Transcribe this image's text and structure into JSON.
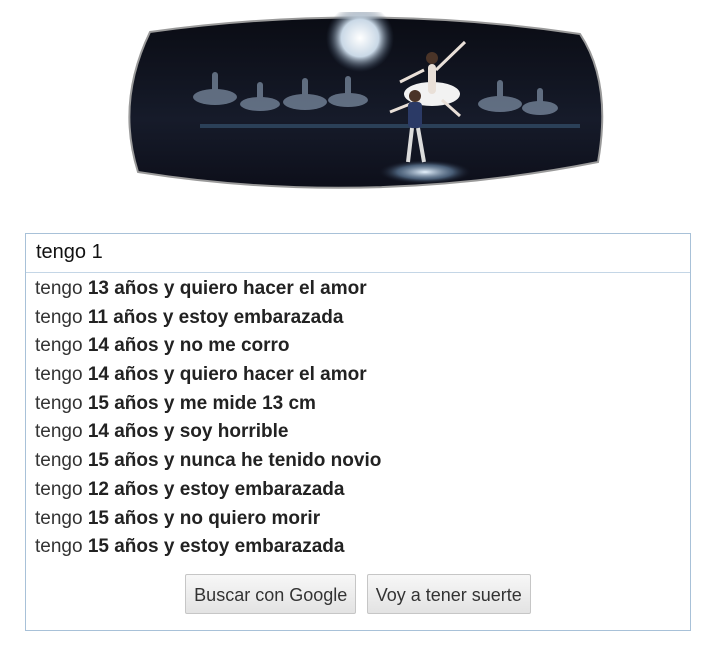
{
  "search": {
    "query": "tengo 1",
    "suggestions": [
      {
        "typed": "tengo ",
        "completion": "13 años y quiero hacer el amor"
      },
      {
        "typed": "tengo ",
        "completion": "11 años y estoy embarazada"
      },
      {
        "typed": "tengo ",
        "completion": "14 años y no me corro"
      },
      {
        "typed": "tengo ",
        "completion": "14 años y quiero hacer el amor"
      },
      {
        "typed": "tengo ",
        "completion": "15 años y me mide 13 cm"
      },
      {
        "typed": "tengo ",
        "completion": "14 años y soy horrible"
      },
      {
        "typed": "tengo ",
        "completion": "15 años y nunca he tenido novio"
      },
      {
        "typed": "tengo ",
        "completion": "12 años y estoy embarazada"
      },
      {
        "typed": "tengo ",
        "completion": "15 años y no quiero morir"
      },
      {
        "typed": "tengo ",
        "completion": "15 años y estoy embarazada"
      }
    ],
    "buttons": {
      "search": "Buscar con Google",
      "lucky": "Voy a tener suerte"
    }
  },
  "doodle": {
    "icon": "ballet-doodle-logo",
    "colors": {
      "background": "#0d0f1a",
      "moon": "#c9d8e6",
      "stage_light": "#e8f4ff"
    }
  }
}
